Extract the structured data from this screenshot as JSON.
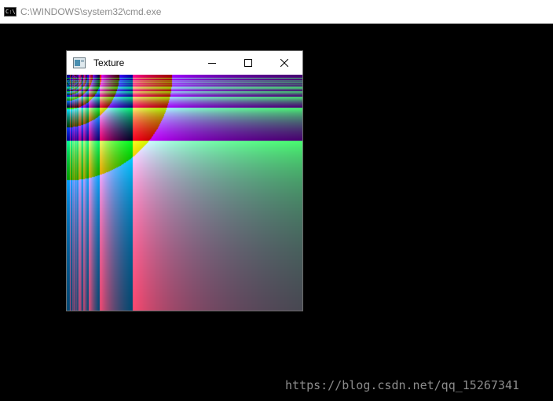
{
  "cmd_window": {
    "icon": "cmd-icon",
    "icon_text": "C:\\",
    "title": "C:\\WINDOWS\\system32\\cmd.exe"
  },
  "texture_window": {
    "icon": "window-app-icon",
    "title": "Texture",
    "controls": {
      "minimize": "minimize-icon",
      "maximize": "maximize-icon",
      "close": "close-icon"
    },
    "content": "procedural-rgb-gradient-texture"
  },
  "watermark": "https://blog.csdn.net/qq_15267341"
}
